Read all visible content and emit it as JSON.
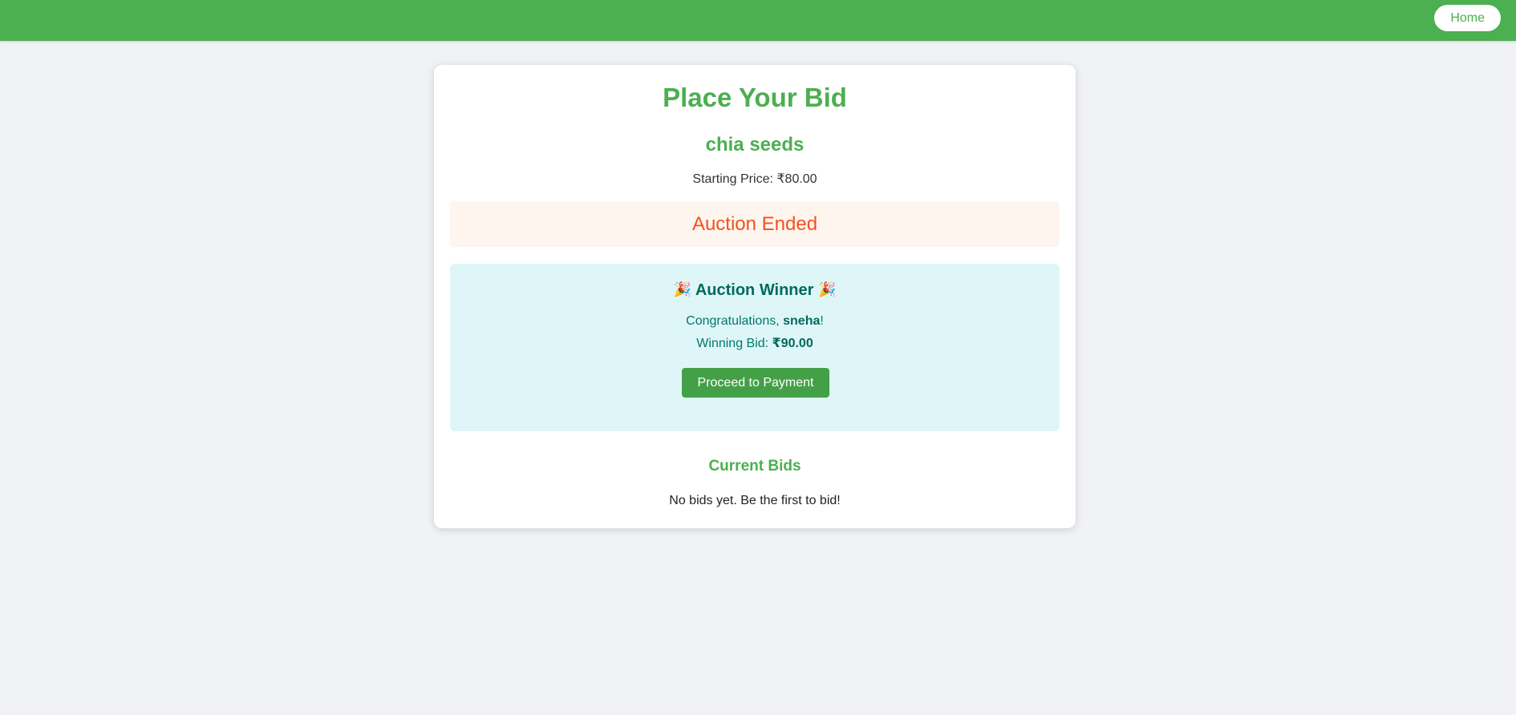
{
  "nav": {
    "home_label": "Home"
  },
  "page": {
    "title": "Place Your Bid",
    "product_name": "chia seeds",
    "starting_price_label": "Starting Price: ",
    "starting_price_value": "₹80.00"
  },
  "status": {
    "text": "Auction Ended"
  },
  "winner": {
    "title": "Auction Winner",
    "icon_left": "🎉",
    "icon_right": "🎉",
    "congrats_prefix": "Congratulations, ",
    "winner_name": "sneha",
    "congrats_suffix": "!",
    "winning_bid_label": "Winning Bid: ",
    "winning_bid_value": "₹90.00",
    "payment_button_label": "Proceed to Payment"
  },
  "bids": {
    "title": "Current Bids",
    "empty_text": "No bids yet. Be the first to bid!"
  },
  "colors": {
    "brand_green": "#4caf50",
    "ended_orange": "#f4511e",
    "winner_bg": "#dff6f8",
    "winner_text": "#00796b"
  }
}
